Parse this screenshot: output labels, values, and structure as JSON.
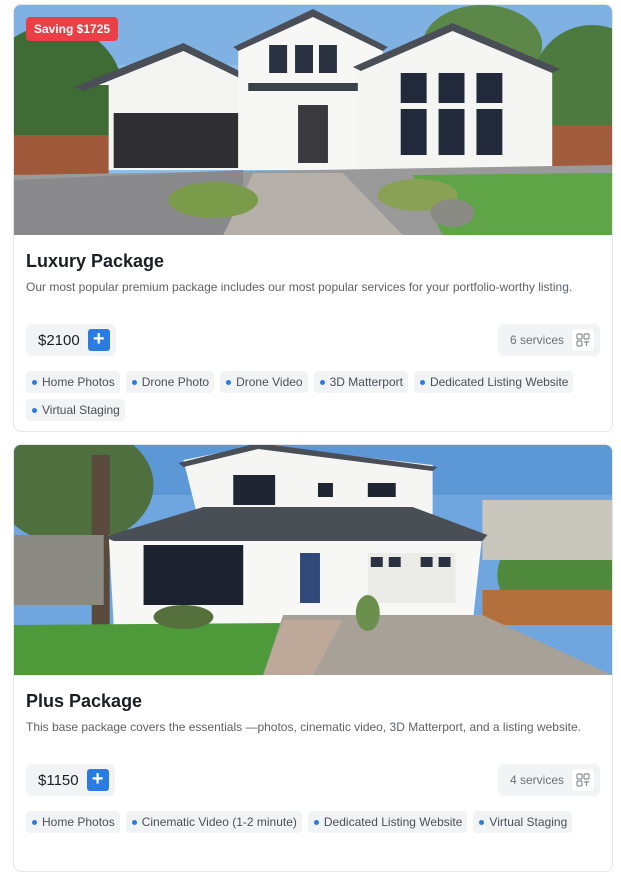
{
  "packages": [
    {
      "badge": "Saving $1725",
      "title": "Luxury Package",
      "description": "Our most popular premium package includes our most popular services for your portfolio-worthy listing.",
      "price": "$2100",
      "add_icon": "plus-icon",
      "services_count": "6 services",
      "services_icon": "grid-icon",
      "tags": [
        "Home Photos",
        "Drone Photo",
        "Drone Video",
        "3D Matterport",
        "Dedicated Listing Website",
        "Virtual Staging"
      ]
    },
    {
      "title": "Plus Package",
      "description": "This base package covers the essentials —photos, cinematic video, 3D Matterport, and a listing website.",
      "price": "$1150",
      "add_icon": "plus-icon",
      "services_count": "4 services",
      "services_icon": "grid-icon",
      "tags": [
        "Home Photos",
        "Cinematic Video (1-2 minute)",
        "Dedicated Listing Website",
        "Virtual Staging"
      ]
    }
  ],
  "colors": {
    "accent": "#2a7ce2",
    "badge": "#ea3f46",
    "chip_bg": "#f2f3f5"
  }
}
